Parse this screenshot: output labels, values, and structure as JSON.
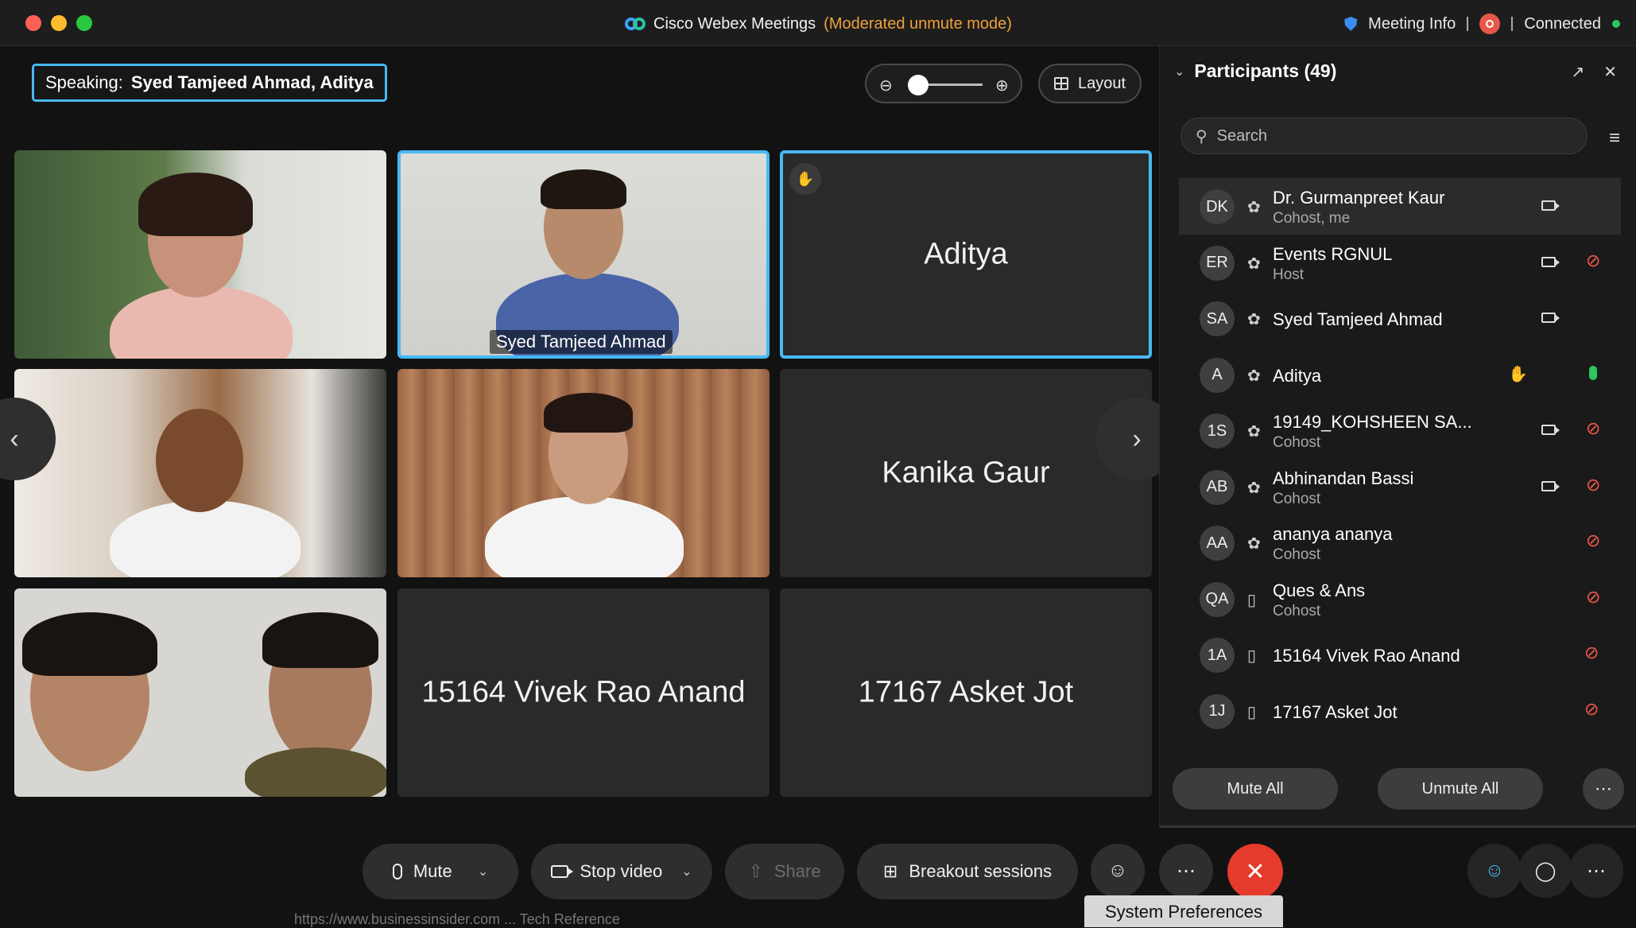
{
  "titlebar": {
    "app_title": "Cisco Webex Meetings",
    "mode": "(Moderated unmute mode)",
    "meeting_info": "Meeting Info",
    "connection": "Connected"
  },
  "speaking": {
    "label": "Speaking:",
    "names": "Syed Tamjeed Ahmad,   Aditya"
  },
  "layout_button": "Layout",
  "tiles": [
    {
      "name": ""
    },
    {
      "name": "Syed Tamjeed Ahmad"
    },
    {
      "name": "Aditya"
    },
    {
      "name": ""
    },
    {
      "name": ""
    },
    {
      "name": "Kanika Gaur"
    },
    {
      "name": ""
    },
    {
      "name": "15164 Vivek Rao Anand"
    },
    {
      "name": "17167 Asket Jot"
    }
  ],
  "toolbar": {
    "mute": "Mute",
    "stop_video": "Stop video",
    "share": "Share",
    "breakout": "Breakout sessions",
    "tooltip": "System Preferences",
    "ghost": "https://www.businessinsider.com   ...   Tech Reference"
  },
  "participants": {
    "title": "Participants (49)",
    "search_placeholder": "Search",
    "mute_all": "Mute All",
    "unmute_all": "Unmute All",
    "list": [
      {
        "initials": "DK",
        "name": "Dr. Gurmanpreet Kaur",
        "role": "Cohost, me"
      },
      {
        "initials": "ER",
        "name": "Events RGNUL",
        "role": "Host"
      },
      {
        "initials": "SA",
        "name": "Syed Tamjeed Ahmad",
        "role": ""
      },
      {
        "initials": "A",
        "name": "Aditya",
        "role": ""
      },
      {
        "initials": "1S",
        "name": "19149_KOHSHEEN SA...",
        "role": "Cohost"
      },
      {
        "initials": "AB",
        "name": "Abhinandan Bassi",
        "role": "Cohost"
      },
      {
        "initials": "AA",
        "name": "ananya ananya",
        "role": "Cohost"
      },
      {
        "initials": "QA",
        "name": "Ques & Ans",
        "role": "Cohost"
      },
      {
        "initials": "1A",
        "name": "15164 Vivek Rao Anand",
        "role": ""
      },
      {
        "initials": "1J",
        "name": "17167 Asket Jot",
        "role": ""
      }
    ]
  },
  "colors": {
    "accent_blue": "#47b9f5",
    "mode_orange": "#f0a13a",
    "end_red": "#e43b2c",
    "mute_red": "#f05a4a",
    "mic_green": "#2fc55d"
  }
}
